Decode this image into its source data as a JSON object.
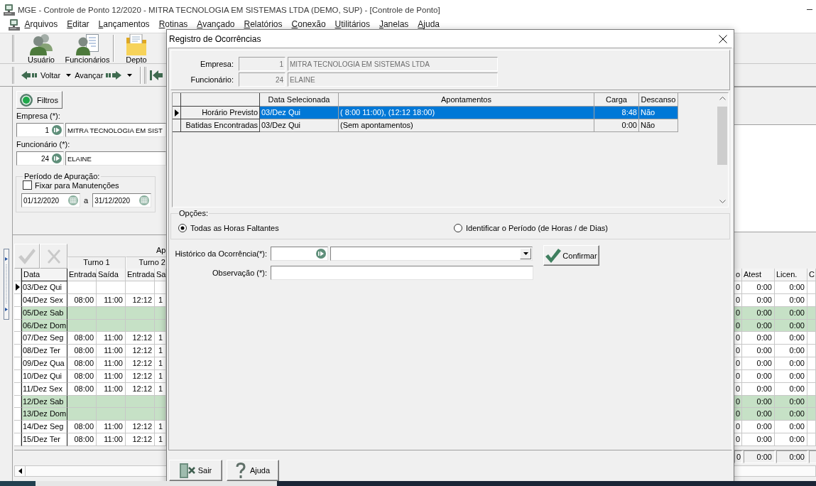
{
  "window": {
    "title": "MGE - Controle de Ponto 12/2020 - MITRA TECNOLOGIA EM SISTEMAS LTDA (DEMO, SUP) - [Controle de Ponto]"
  },
  "menu": [
    "Arquivos",
    "Editar",
    "Lançamentos",
    "Rotinas",
    "Avançado",
    "Relatórios",
    "Conexão",
    "Utilitários",
    "Janelas",
    "Ajuda"
  ],
  "toolbar": {
    "buttons": [
      {
        "kind": "users",
        "label": "Usuário"
      },
      {
        "kind": "employees",
        "label": "Funcionários"
      },
      {
        "kind": "folder",
        "label": "Depto"
      }
    ],
    "navigation": [
      {
        "kind": "back",
        "label": "Voltar"
      },
      {
        "kind": "forward",
        "label": "Avançar"
      }
    ]
  },
  "filters": {
    "button": "Filtros",
    "fields": [
      {
        "label": "Empresa (*):",
        "code": "1",
        "name": "MITRA TECNOLOGIA EM SIST"
      },
      {
        "label": "Funcionário (*):",
        "code": "24",
        "name": "ELAINE"
      }
    ],
    "period": {
      "title": "Período de Apuração:",
      "fix": {
        "label": "Fixar para Manutenções",
        "checked": false
      },
      "from": "01/12/2020",
      "between": "a",
      "to": "31/12/2020"
    }
  },
  "grid": {
    "actions": [
      {
        "kind": "confirm",
        "disabled": true
      },
      {
        "kind": "cancel",
        "disabled": true
      }
    ],
    "group_header": "Ap",
    "shifts": [
      "Turno 1",
      "Turno 2"
    ],
    "columns": [
      "Data",
      "Entrada",
      "Saída",
      "Entrada",
      "Sa"
    ],
    "right_columns": [
      "o",
      "Atest",
      "Licen.",
      "C"
    ],
    "rows": [
      {
        "date": "03/Dez Qui",
        "selected": true,
        "weekend": false,
        "right_cells": [
          "0",
          "0:00",
          "0:00"
        ]
      },
      {
        "date": "04/Dez Sex",
        "selected": false,
        "weekend": false,
        "cells": [
          "08:00",
          "11:00",
          "12:12",
          "1"
        ],
        "right_cells": [
          "0",
          "0:00",
          "0:00"
        ]
      },
      {
        "date": "05/Dez Sab",
        "selected": false,
        "weekend": true,
        "right_cells": [
          "0",
          "0:00",
          "0:00"
        ]
      },
      {
        "date": "06/Dez Dom",
        "selected": false,
        "weekend": true,
        "right_cells": [
          "0",
          "0:00",
          "0:00"
        ]
      },
      {
        "date": "07/Dez Seg",
        "selected": false,
        "weekend": false,
        "cells": [
          "08:00",
          "11:00",
          "12:12",
          "1"
        ],
        "right_cells": [
          "0",
          "0:00",
          "0:00"
        ]
      },
      {
        "date": "08/Dez Ter",
        "selected": false,
        "weekend": false,
        "cells": [
          "08:00",
          "11:00",
          "12:12",
          "1"
        ],
        "right_cells": [
          "0",
          "0:00",
          "0:00"
        ]
      },
      {
        "date": "09/Dez Qua",
        "selected": false,
        "weekend": false,
        "cells": [
          "08:00",
          "11:00",
          "12:12",
          "1"
        ],
        "right_cells": [
          "0",
          "0:00",
          "0:00"
        ]
      },
      {
        "date": "10/Dez Qui",
        "selected": false,
        "weekend": false,
        "cells": [
          "08:00",
          "11:00",
          "12:12",
          "1"
        ],
        "right_cells": [
          "0",
          "0:00",
          "0:00"
        ]
      },
      {
        "date": "11/Dez Sex",
        "selected": false,
        "weekend": false,
        "cells": [
          "08:00",
          "11:00",
          "12:12",
          "1"
        ],
        "right_cells": [
          "0",
          "0:00",
          "0:00"
        ]
      },
      {
        "date": "12/Dez Sab",
        "selected": false,
        "weekend": true,
        "right_cells": [
          "0",
          "0:00",
          "0:00"
        ]
      },
      {
        "date": "13/Dez Dom",
        "selected": false,
        "weekend": true,
        "right_cells": [
          "0",
          "0:00",
          "0:00"
        ]
      },
      {
        "date": "14/Dez Seg",
        "selected": false,
        "weekend": false,
        "cells": [
          "08:00",
          "11:00",
          "12:12",
          "1"
        ],
        "right_cells": [
          "0",
          "0:00",
          "0:00"
        ]
      },
      {
        "date": "15/Dez Ter",
        "selected": false,
        "weekend": false,
        "cells": [
          "08:00",
          "11:00",
          "12:12",
          "1"
        ],
        "right_cells": [
          "0",
          "0:00",
          "0:00"
        ]
      }
    ],
    "totals": [
      "0",
      "0:00",
      "0:00"
    ]
  },
  "dialog": {
    "title": "Registro de Ocorrências",
    "header_fields": [
      {
        "label": "Empresa:",
        "code": "1",
        "name": "MITRA TECNOLOGIA EM SISTEMAS LTDA",
        "disabled": true
      },
      {
        "label": "Funcionário:",
        "code": "24",
        "name": "ELAINE",
        "disabled": true
      }
    ],
    "grid": {
      "columns": [
        "Data Selecionada",
        "Apontamentos",
        "Carga",
        "Descanso"
      ],
      "rows": [
        {
          "label": "Horário Previsto",
          "date": "03/Dez Qui",
          "entries": "( 8:00 11:00), (12:12 18:00)",
          "load": "8:48",
          "rest": "Não",
          "selected": true
        },
        {
          "label": "Batidas Encontradas",
          "date": "03/Dez Qui",
          "entries": "(Sem apontamentos)",
          "load": "0:00",
          "rest": "Não",
          "selected": false
        }
      ]
    },
    "options": {
      "title": "Opções:",
      "choices": [
        {
          "label": "Todas as Horas Faltantes",
          "selected": true
        },
        {
          "label": "Identificar o Período (de Horas / de Dias)",
          "selected": false
        }
      ]
    },
    "form": {
      "history_label": "Histórico da Ocorrência(*):",
      "note_label": "Observação (*):"
    },
    "confirm": "Confirmar",
    "buttons": [
      {
        "kind": "exit",
        "label": "Sair"
      },
      {
        "kind": "help",
        "label": "Ajuda"
      }
    ]
  }
}
